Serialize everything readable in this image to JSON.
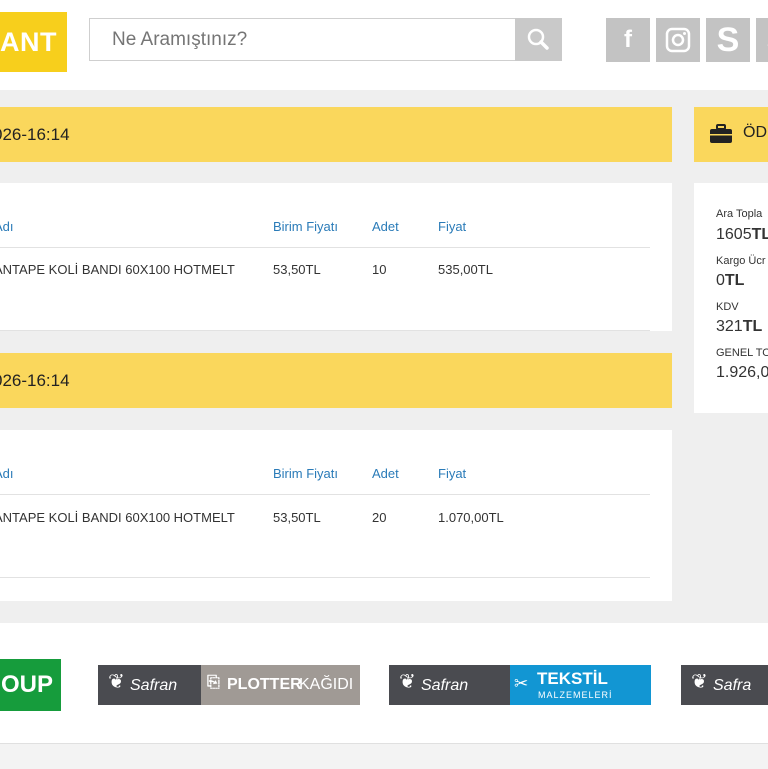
{
  "header": {
    "logo_text": "ANT",
    "search": {
      "placeholder": "Ne Aramıştınız?"
    },
    "social_icons": [
      "facebook-icon",
      "instagram-icon",
      "skype-icon",
      "skype-icon"
    ],
    "social_letters": {
      "skype": "S",
      "extra": "S"
    }
  },
  "orders": [
    {
      "date": "026-16:14",
      "columns": {
        "name": "Adı",
        "unit_price": "Birim Fiyatı",
        "qty": "Adet",
        "price": "Fiyat"
      },
      "items": [
        {
          "name": "ANTAPE KOLİ BANDI 60X100 HOTMELT",
          "unit_price": "53,50TL",
          "qty": "10",
          "price": "535,00TL"
        }
      ]
    },
    {
      "date": "026-16:14",
      "columns": {
        "name": "Adı",
        "unit_price": "Birim Fiyatı",
        "qty": "Adet",
        "price": "Fiyat"
      },
      "items": [
        {
          "name": "ANTAPE KOLİ BANDI 60X100 HOTMELT",
          "unit_price": "53,50TL",
          "qty": "20",
          "price": "1.070,00TL"
        }
      ]
    }
  ],
  "summary": {
    "title": "ÖD",
    "subtotal_label": "Ara Topla",
    "subtotal_value": "1605",
    "subtotal_unit": "TL",
    "shipping_label": "Kargo Ücr",
    "shipping_value": "0",
    "shipping_unit": "TL",
    "tax_label": "KDV",
    "tax_value": "321",
    "tax_unit": "TL",
    "total_label": "GENEL TO",
    "total_value": "1.926,0"
  },
  "brands": {
    "b1": "OUP",
    "b2_name": "Safran",
    "b2_tag": "PLOTTER",
    "b2_tag2": "KAĞIDI",
    "b3_name": "Safran",
    "b3_tag": "TEKSTİL",
    "b3_sub": "MALZEMELERİ",
    "b4_name": "Safra"
  },
  "colors": {
    "accent_yellow": "#fad75c",
    "logo_yellow": "#f7cf1c",
    "link_blue": "#2a7bb8",
    "brand_green": "#169c3c",
    "brand_gray": "#4a4b50",
    "brand_blue": "#1296d3"
  }
}
